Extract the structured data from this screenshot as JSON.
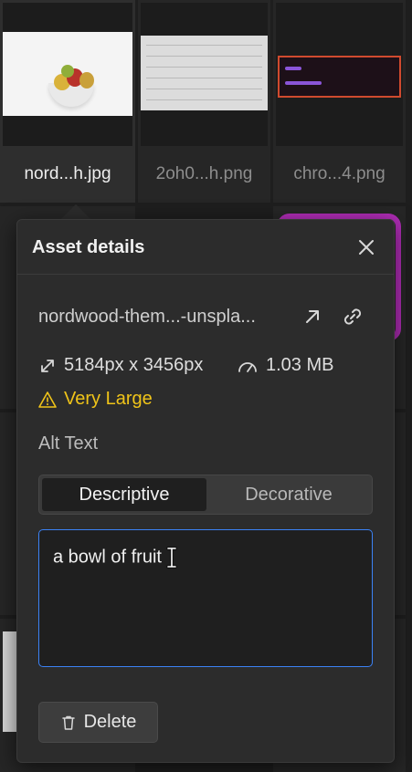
{
  "grid": {
    "tiles": [
      {
        "label": "nord...h.jpg"
      },
      {
        "label": "2oh0...h.png"
      },
      {
        "label": "chro...4.png"
      }
    ]
  },
  "dialog": {
    "title": "Asset details",
    "filename": "nordwood-them...-unspla...",
    "dimensions": "5184px x 3456px",
    "filesize": "1.03 MB",
    "size_warning": "Very Large",
    "alt_text_label": "Alt Text",
    "alt_mode": {
      "options": [
        "Descriptive",
        "Decorative"
      ],
      "selected": "Descriptive"
    },
    "alt_text_value": "a bowl of fruit",
    "delete_label": "Delete"
  },
  "colors": {
    "accent_focus": "#3b82f6",
    "warning": "#f0c419",
    "dialog_bg": "#2c2c2c"
  },
  "icons": [
    "close-icon",
    "open-external-icon",
    "copy-link-icon",
    "resize-icon",
    "gauge-icon",
    "warning-icon",
    "trash-icon",
    "text-cursor-icon"
  ]
}
